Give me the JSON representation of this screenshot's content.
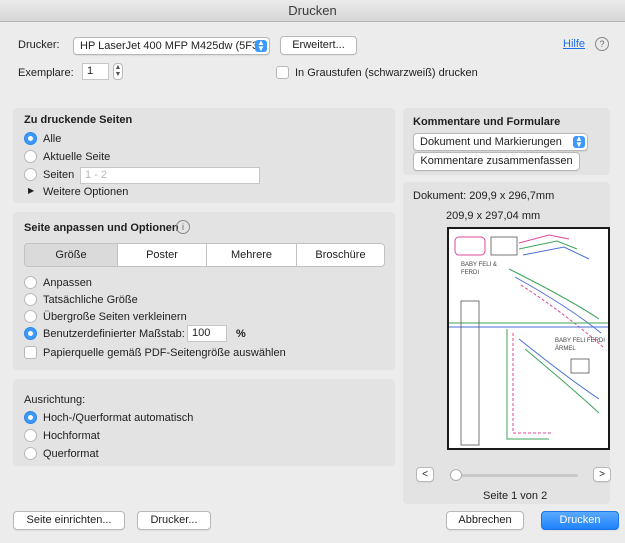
{
  "window": {
    "title": "Drucken"
  },
  "header": {
    "printer_label": "Drucker:",
    "printer_value": "HP LaserJet 400 MFP M425dw (5F3...",
    "advanced_button": "Erweitert...",
    "help_link": "Hilfe",
    "help_icon": "?",
    "copies_label": "Exemplare:",
    "copies_value": "1",
    "grayscale_label": "In Graustufen (schwarzweiß) drucken",
    "grayscale_checked": false
  },
  "pages": {
    "heading": "Zu druckende Seiten",
    "options": [
      {
        "label": "Alle",
        "selected": true
      },
      {
        "label": "Aktuelle Seite",
        "selected": false
      },
      {
        "label": "Seiten",
        "selected": false
      }
    ],
    "range_placeholder": "1 - 2",
    "more_options": "Weitere Optionen"
  },
  "fit": {
    "heading": "Seite anpassen und Optionen",
    "info_icon": "i",
    "tabs": [
      {
        "label": "Größe",
        "selected": true
      },
      {
        "label": "Poster",
        "selected": false
      },
      {
        "label": "Mehrere",
        "selected": false
      },
      {
        "label": "Broschüre",
        "selected": false
      }
    ],
    "options": [
      {
        "label": "Anpassen",
        "selected": false
      },
      {
        "label": "Tatsächliche Größe",
        "selected": false
      },
      {
        "label": "Übergroße Seiten verkleinern",
        "selected": false
      },
      {
        "label": "Benutzerdefinierter Maßstab:",
        "selected": true
      }
    ],
    "scale_value": "100",
    "scale_unit": "%",
    "paper_source_label": "Papierquelle gemäß PDF-Seitengröße auswählen",
    "paper_source_checked": false
  },
  "orientation": {
    "heading": "Ausrichtung:",
    "options": [
      {
        "label": "Hoch-/Querformat automatisch",
        "selected": true
      },
      {
        "label": "Hochformat",
        "selected": false
      },
      {
        "label": "Querformat",
        "selected": false
      }
    ]
  },
  "comments": {
    "heading": "Kommentare und Formulare",
    "select_value": "Dokument und Markierungen",
    "summarize_button": "Kommentare zusammenfassen"
  },
  "preview": {
    "document_size": "Dokument: 209,9 x 296,7mm",
    "page_size": "209,9 x 297,04 mm",
    "page_indicator": "Seite 1 von 2",
    "prev_button": "<",
    "next_button": ">",
    "page_texts": [
      "BABY FELI & FERDI",
      "BABY FELI FERDI ÄRMEL"
    ]
  },
  "footer": {
    "page_setup_button": "Seite einrichten...",
    "printer_button": "Drucker...",
    "cancel_button": "Abbrechen",
    "print_button": "Drucken"
  },
  "colors": {
    "accent": "#3b99fc",
    "pattern_pink": "#e0479a",
    "pattern_green": "#3da35a",
    "pattern_blue": "#4b6fd6"
  }
}
